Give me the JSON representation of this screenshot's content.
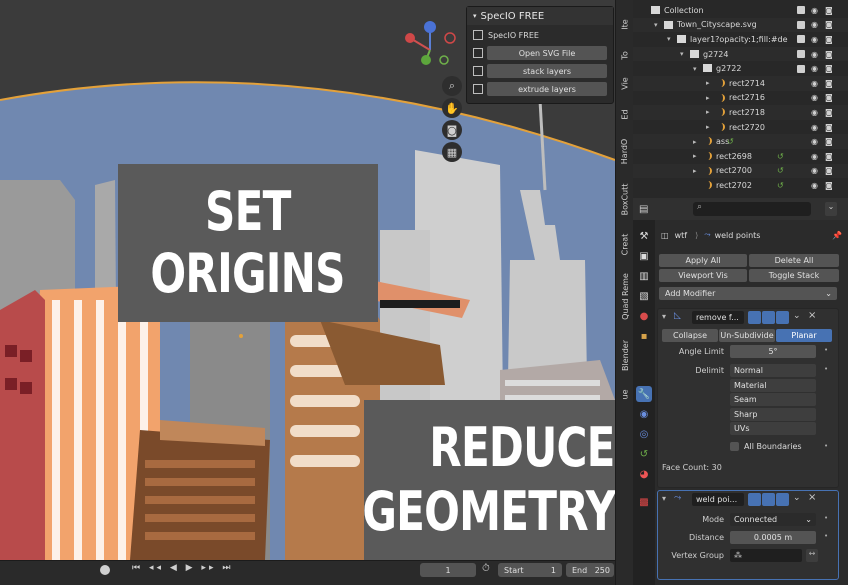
{
  "overlay": {
    "set_line1": "SET",
    "set_line2": "ORIGINS",
    "reduce_line1": "REDUCE",
    "reduce_line2": "GEOMETRY"
  },
  "specio": {
    "title": "SpecIO FREE",
    "subtitle": "SpecIO FREE",
    "open_svg": "Open SVG File",
    "stack_layers": "stack layers",
    "extrude_layers": "extrude layers"
  },
  "sidebar_tabs": [
    "Ite",
    "To",
    "Vie",
    "Ed",
    "HardO",
    "BoxCutt",
    "Creat",
    "Quad Reme",
    "Blender",
    "ue"
  ],
  "outliner": {
    "rows": [
      {
        "label": "Collection",
        "indent": 0
      },
      {
        "label": "Town_Cityscape.svg",
        "indent": 1
      },
      {
        "label": "layer1?opacity:1;fill:#de",
        "indent": 2
      },
      {
        "label": "g2724",
        "indent": 3
      },
      {
        "label": "g2722",
        "indent": 4
      },
      {
        "label": "rect2714",
        "indent": 5
      },
      {
        "label": "rect2716",
        "indent": 5
      },
      {
        "label": "rect2718",
        "indent": 5
      },
      {
        "label": "rect2720",
        "indent": 5
      },
      {
        "label": "ass",
        "indent": 4
      },
      {
        "label": "rect2698",
        "indent": 4
      },
      {
        "label": "rect2700",
        "indent": 4
      },
      {
        "label": "rect2702",
        "indent": 4
      }
    ]
  },
  "properties": {
    "object_name": "wtf",
    "modifier_target": "weld points",
    "apply_all": "Apply All",
    "delete_all": "Delete All",
    "viewport_vis": "Viewport Vis",
    "toggle_stack": "Toggle Stack",
    "add_modifier": "Add Modifier",
    "decimate": {
      "name": "remove f...",
      "tabs": [
        "Collapse",
        "Un-Subdivide",
        "Planar"
      ],
      "active_tab": "Planar",
      "angle_limit_label": "Angle Limit",
      "angle_limit_value": "5°",
      "delimit_label": "Delimit",
      "delimit_options": [
        "Normal",
        "Material",
        "Seam",
        "Sharp",
        "UVs"
      ],
      "all_boundaries": "All Boundaries",
      "face_count": "Face Count: 30"
    },
    "weld": {
      "name": "weld poi...",
      "mode_label": "Mode",
      "mode_value": "Connected",
      "distance_label": "Distance",
      "distance_value": "0.0005 m",
      "vertex_group_label": "Vertex Group"
    }
  },
  "timeline": {
    "current_frame": "1",
    "start_label": "Start",
    "start_value": "1",
    "end_label": "End",
    "end_value": "250"
  },
  "colors": {
    "sky": "#7088b0",
    "accent_blue": "#4772b3",
    "selection_orange": "#e3a13a"
  }
}
